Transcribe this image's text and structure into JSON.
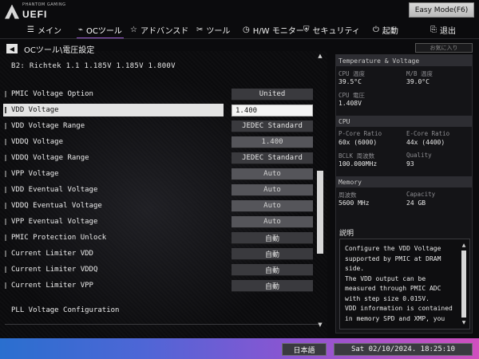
{
  "logo": {
    "brand_small": "PHANTOM GAMING",
    "brand": "UEFI"
  },
  "easy_mode_label": "Easy Mode(F6)",
  "tabs": [
    {
      "icon": "☰",
      "label": "メイン"
    },
    {
      "icon": "⌁",
      "label": "OCツール"
    },
    {
      "icon": "☆",
      "label": "アドバンスド"
    },
    {
      "icon": "✂",
      "label": "ツール"
    },
    {
      "icon": "◷",
      "label": "H/W モニター"
    },
    {
      "icon": "⛨",
      "label": "セキュリティ"
    },
    {
      "icon": "⏻",
      "label": "起動"
    },
    {
      "icon": "⎘",
      "label": "退出"
    }
  ],
  "breadcrumb": "OCツール\\電圧設定",
  "search_placeholder": "お気に入り",
  "info_line": "B2: Richtek  1.1  1.185V  1.185V  1.800V",
  "rows": [
    {
      "label": "PMIC Voltage Option",
      "value": "United"
    },
    {
      "label": "VDD  Voltage",
      "value": "1.400"
    },
    {
      "label": "VDD  Voltage Range",
      "value": "JEDEC Standard"
    },
    {
      "label": "VDDQ Voltage",
      "value": "1.400"
    },
    {
      "label": "VDDQ Voltage Range",
      "value": "JEDEC Standard"
    },
    {
      "label": "VPP  Voltage",
      "value": "Auto"
    },
    {
      "label": "VDD  Eventual Voltage",
      "value": "Auto"
    },
    {
      "label": "VDDQ Eventual Voltage",
      "value": "Auto"
    },
    {
      "label": "VPP  Eventual Voltage",
      "value": "Auto"
    },
    {
      "label": "PMIC Protection Unlock",
      "value": "自動"
    },
    {
      "label": "Current Limiter VDD",
      "value": "自動"
    },
    {
      "label": "Current Limiter VDDQ",
      "value": "自動"
    },
    {
      "label": "Current Limiter VPP",
      "value": "自動"
    }
  ],
  "pll_label": "PLL Voltage Configuration",
  "panel": {
    "tv_header": "Temperature & Voltage",
    "cpu_temp_label": "CPU 温度",
    "cpu_temp": "39.5°C",
    "mb_temp_label": "M/B 温度",
    "mb_temp": "39.0°C",
    "cpu_volt_label": "CPU 電圧",
    "cpu_volt": "1.408V",
    "cpu_header": "CPU",
    "pcore_label": "P-Core Ratio",
    "pcore": "60x (6000)",
    "ecore_label": "E-Core Ratio",
    "ecore": "44x (4400)",
    "bclk_label": "BCLK 周波数",
    "bclk": "100.000MHz",
    "quality_label": "Quality",
    "quality": "93",
    "mem_header": "Memory",
    "freq_label": "周波数",
    "freq": "5600 MHz",
    "cap_label": "Capacity",
    "cap": "24 GB",
    "desc_header": "説明",
    "desc": "Configure the VDD Voltage supported by PMIC at DRAM side.\nThe VDD output can be measured through PMIC ADC with step size 0.015V.\nVDD information is contained in memory SPD and XMP, you"
  },
  "footer": {
    "language": "日本語",
    "datetime": "Sat 02/10/2024. 18:25:10"
  }
}
